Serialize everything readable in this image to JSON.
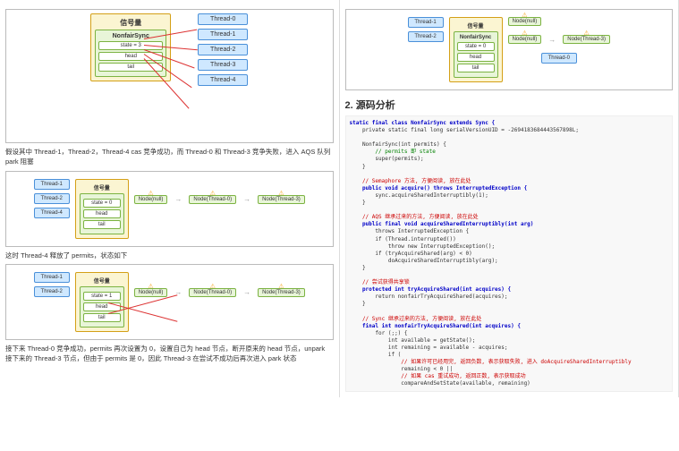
{
  "diagram_common": {
    "semaphore_title": "信号量",
    "sync_title": "NonfairSync",
    "fields": {
      "head": "head",
      "tail": "tail"
    }
  },
  "d1": {
    "state": "state = 3",
    "threads": [
      "Thread-0",
      "Thread-1",
      "Thread-2",
      "Thread-3",
      "Thread-4"
    ]
  },
  "para1": "假设其中 Thread-1，Thread-2，Thread-4 cas 竞争成功，而 Thread-0 和 Thread-3 竞争失败，进入 AQS 队列 park 阻塞",
  "d2": {
    "state": "state = 0",
    "threads": [
      "Thread-1",
      "Thread-2",
      "Thread-4"
    ],
    "nodes": [
      "Node(null)",
      "Node(Thread-0)",
      "Node(Thread-3)"
    ]
  },
  "para2": "这时 Thread-4 释放了 permits，状态如下",
  "d3": {
    "state": "state = 1",
    "threads": [
      "Thread-1",
      "Thread-2"
    ],
    "nodes": [
      "Node(null)",
      "Node(Thread-0)",
      "Node(Thread-3)"
    ]
  },
  "para3": "接下来 Thread-0 竞争成功，permits 再次设置为 0，设置自己为 head 节点，断开原来的 head 节点，unpark 接下来的 Thread-3 节点，但由于 permits 是 0，因此 Thread-3 在尝试不成功后再次进入 park 状态",
  "d4": {
    "state": "state = 0",
    "threads": [
      "Thread-1",
      "Thread-2",
      "Thread-0"
    ],
    "nodes_top": "Node(null)",
    "nodes": [
      "Node(null)",
      "Node(Thread-3)"
    ]
  },
  "section2": "2. 源码分析",
  "code": {
    "l1": "static final class NonfairSync extends Sync {",
    "l2": "    private static final long serialVersionUID = -2694183684443567898L;",
    "l3": "",
    "l4": "    NonfairSync(int permits) {",
    "l5a": "        // permits 即 state",
    "l5": "        super(permits);",
    "l6": "    }",
    "l7": "",
    "l8": "    // Semaphore 方法, 方便阅读, 放在此处",
    "l9": "    public void acquire() throws InterruptedException {",
    "l10": "        sync.acquireSharedInterruptibly(1);",
    "l11": "    }",
    "l12": "",
    "l13": "    // AQS 继承过来的方法, 方便阅读, 放在此处",
    "l14": "    public final void acquireSharedInterruptibly(int arg)",
    "l15": "        throws InterruptedException {",
    "l16": "        if (Thread.interrupted())",
    "l17": "            throw new InterruptedException();",
    "l18": "        if (tryAcquireShared(arg) < 0)",
    "l19": "            doAcquireSharedInterruptibly(arg);",
    "l20": "    }",
    "l21": "",
    "l22": "    // 尝试获得共享锁",
    "l23": "    protected int tryAcquireShared(int acquires) {",
    "l24": "        return nonfairTryAcquireShared(acquires);",
    "l25": "    }",
    "l26": "",
    "l27": "    // Sync 继承过来的方法, 方便阅读, 放在此处",
    "l28": "    final int nonfairTryAcquireShared(int acquires) {",
    "l29": "        for (;;) {",
    "l30": "            int available = getState();",
    "l31": "            int remaining = available - acquires;",
    "l32": "            if (",
    "l33": "                // 如果许可已经用完, 返回负数, 表示获取失败, 进入 doAcquireSharedInterruptibly",
    "l34": "                remaining < 0 ||",
    "l35": "                // 如果 cas 重试成功, 返回正数, 表示获取成功",
    "l36": "                compareAndSetState(available, remaining)"
  }
}
